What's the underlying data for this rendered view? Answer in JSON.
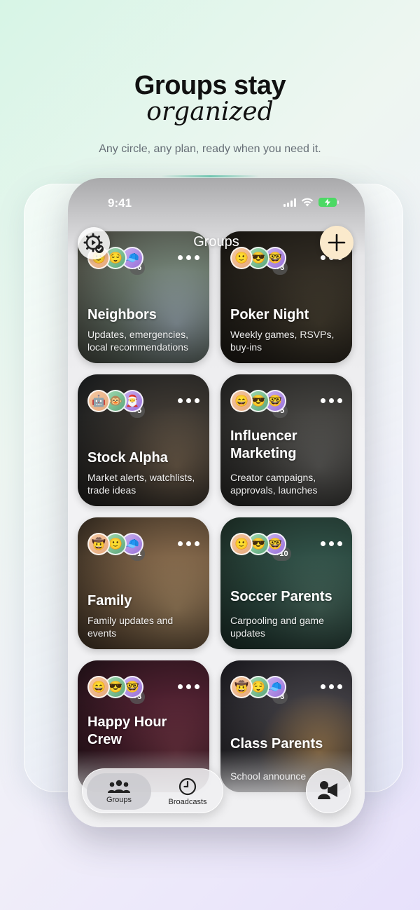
{
  "hero": {
    "title_line1": "Groups stay",
    "title_line2": "organized",
    "subtitle": "Any circle, any plan, ready when you need it."
  },
  "status_bar": {
    "time": "9:41"
  },
  "header": {
    "title": "Groups"
  },
  "groups": [
    {
      "name": "Neighbors",
      "description": "Updates, emergencies, local recommendations",
      "extra_members": "+6",
      "avatars": [
        "🙂",
        "😌",
        "🧢"
      ],
      "bg": [
        "#a7b7c0",
        "#6c7a6e",
        "#3d3a32"
      ]
    },
    {
      "name": "Poker Night",
      "description": "Weekly games, RSVPs, buy-ins",
      "extra_members": "+3",
      "avatars": [
        "🙂",
        "😎",
        "🤓"
      ],
      "bg": [
        "#4e4636",
        "#2f2a22",
        "#14120e"
      ]
    },
    {
      "name": "Stock Alpha",
      "description": "Market alerts, watchlists, trade ideas",
      "extra_members": "+5",
      "avatars": [
        "🤖",
        "🐵",
        "🎅"
      ],
      "bg": [
        "#7d6a55",
        "#3b3630",
        "#15181a"
      ]
    },
    {
      "name": "Influencer Marketing",
      "description": "Creator campaigns, approvals, launches",
      "extra_members": "+5",
      "avatars": [
        "😄",
        "😎",
        "🤓"
      ],
      "bg": [
        "#6b6a67",
        "#403f3c",
        "#1c1c1b"
      ]
    },
    {
      "name": "Family",
      "description": "Family updates and events",
      "extra_members": "+1",
      "avatars": [
        "🤠",
        "🙂",
        "🧢"
      ],
      "bg": [
        "#b2926a",
        "#7a6045",
        "#2c241b"
      ]
    },
    {
      "name": "Soccer Parents",
      "description": "Carpooling and game updates",
      "extra_members": "+10",
      "avatars": [
        "🙂",
        "😎",
        "🤓"
      ],
      "bg": [
        "#4f7366",
        "#2e4d44",
        "#18261f"
      ]
    },
    {
      "name": "Happy Hour Crew",
      "description": "",
      "extra_members": "+3",
      "avatars": [
        "😄",
        "😎",
        "🤓"
      ],
      "bg": [
        "#7b3a4a",
        "#4b1f2e",
        "#1c0f14"
      ]
    },
    {
      "name": "Class Parents",
      "description": "School announce",
      "extra_members": "+3",
      "avatars": [
        "🤠",
        "😌",
        "🧢"
      ],
      "bg": [
        "#b08a5a",
        "#3d3b40",
        "#16151a"
      ]
    }
  ],
  "bottom_nav": {
    "items": [
      {
        "label": "Groups",
        "icon": "people-icon",
        "active": true
      },
      {
        "label": "Broadcasts",
        "icon": "clock-icon",
        "active": false
      }
    ]
  },
  "colors": {
    "add_button": "#fbeacc",
    "accent_green": "#4cd964"
  }
}
